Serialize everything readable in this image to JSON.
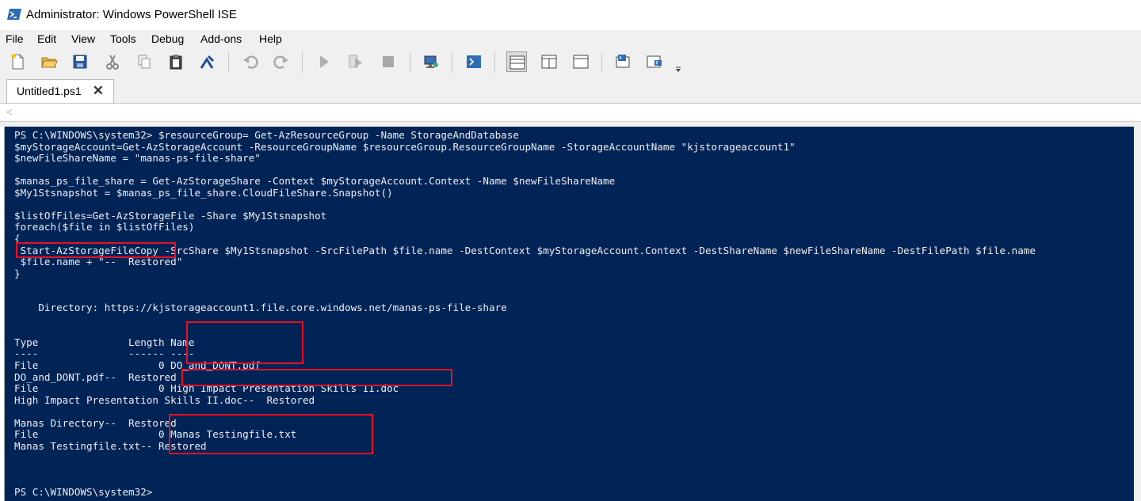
{
  "window": {
    "title": "Administrator: Windows PowerShell ISE",
    "icon": "powershell-ise-icon"
  },
  "menu": [
    "File",
    "Edit",
    "View",
    "Tools",
    "Debug",
    "Add-ons",
    "Help"
  ],
  "toolbar": [
    {
      "name": "new-icon"
    },
    {
      "name": "open-icon"
    },
    {
      "name": "save-icon"
    },
    {
      "name": "cut-icon"
    },
    {
      "name": "copy-icon"
    },
    {
      "name": "paste-icon"
    },
    {
      "name": "clear-console-icon"
    },
    {
      "name": "undo-icon"
    },
    {
      "name": "redo-icon"
    },
    {
      "name": "run-icon"
    },
    {
      "name": "run-selection-icon"
    },
    {
      "name": "stop-icon"
    },
    {
      "name": "remote-powershell-icon"
    },
    {
      "name": "start-powershell-icon"
    },
    {
      "name": "show-script-top-icon"
    },
    {
      "name": "show-script-right-icon"
    },
    {
      "name": "show-script-maximized-icon"
    },
    {
      "name": "show-command-window-icon"
    },
    {
      "name": "show-command-addon-icon"
    },
    {
      "name": "toolbar-overflow-icon"
    }
  ],
  "tab": {
    "label": "Untitled1.ps1",
    "close": "✕"
  },
  "scroll": {
    "left_arrow": "<"
  },
  "colors": {
    "console_bg": "#012456",
    "console_fg": "#eeedf0",
    "highlight": "#e81123"
  },
  "console_lines": [
    "PS C:\\WINDOWS\\system32> $resourceGroup= Get-AzResourceGroup -Name StorageAndDatabase",
    "$myStorageAccount=Get-AzStorageAccount -ResourceGroupName $resourceGroup.ResourceGroupName -StorageAccountName \"kjstorageaccount1\"",
    "$newFileShareName = \"manas-ps-file-share\"",
    "",
    "$manas_ps_file_share = Get-AzStorageShare -Context $myStorageAccount.Context -Name $newFileShareName",
    "$My1Stsnapshot = $manas_ps_file_share.CloudFileShare.Snapshot()",
    "",
    "$listOfFiles=Get-AzStorageFile -Share $My1Stsnapshot",
    "foreach($file in $listOfFiles)",
    "{",
    " Start-AzStorageFileCopy -SrcShare $My1Stsnapshot -SrcFilePath $file.name -DestContext $myStorageAccount.Context -DestShareName $newFileShareName -DestFilePath $file.name",
    " $file.name + \"--  Restored\"",
    "}",
    "",
    "",
    "    Directory: https://kjstorageaccount1.file.core.windows.net/manas-ps-file-share",
    "",
    "",
    "Type               Length Name",
    "----               ------ ----",
    "File                    0 DO_and_DONT.pdf",
    "DO_and_DONT.pdf--  Restored",
    "File                    0 High Impact Presentation Skills II.doc",
    "High Impact Presentation Skills II.doc--  Restored",
    "",
    "Manas Directory--  Restored",
    "File                    0 Manas Testingfile.txt",
    "Manas Testingfile.txt-- Restored",
    "",
    "",
    "",
    "PS C:\\WINDOWS\\system32>"
  ]
}
